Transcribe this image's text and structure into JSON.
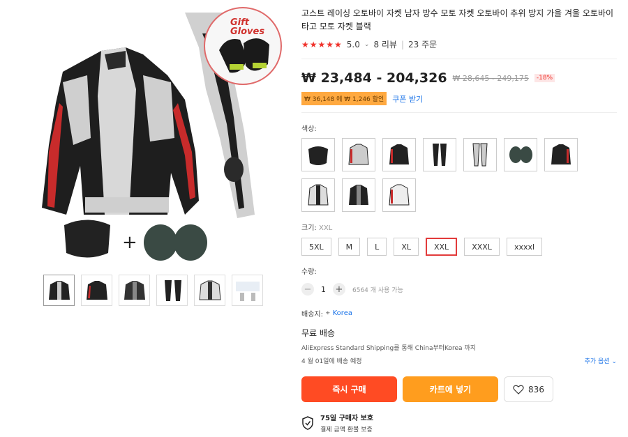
{
  "gallery": {
    "gift_label_1": "Gift",
    "gift_label_2": "Gloves",
    "thumbnails": [
      "jacket-front-1",
      "jacket-front-2",
      "jacket-front-3",
      "pants",
      "jacket-white",
      "size-chart"
    ]
  },
  "product": {
    "title": "고스트 레이싱 오토바이 자켓 남자 방수 모토 자켓 오토바이 추위 방지 가을 겨울 오토바이 타고 모토 자켓 블랙",
    "stars": "★★★★★",
    "rating": "5.0",
    "reviews": "8 리뷰",
    "orders": "23 주문"
  },
  "price": {
    "current": "₩ 23,484 - 204,326",
    "original": "₩ 28,645 - 249,175",
    "discount": "-18%",
    "coupon": "₩ 36,148 에 ₩ 1,246 할인",
    "coupon_link": "쿠폰 받기"
  },
  "color": {
    "label": "색상:",
    "options": [
      "neck-brace",
      "jacket-white-red",
      "jacket-black",
      "pants-black",
      "pants-white",
      "knee-pads",
      "jacket-black-red",
      "jacket-white-2",
      "jacket-black-2",
      "jacket-white-3"
    ]
  },
  "size": {
    "label": "크기:",
    "selected": "XXL",
    "options": [
      "5XL",
      "M",
      "L",
      "XL",
      "XXL",
      "XXXL",
      "xxxxl"
    ]
  },
  "quantity": {
    "label": "수량:",
    "value": "1",
    "minus": "−",
    "plus": "+",
    "available": "6564 개 사용 가능"
  },
  "shipping": {
    "to_label": "배송지:",
    "location": "Korea",
    "free": "무료 배송",
    "desc": "AliExpress Standard Shipping를 통해 China부터Korea 까지",
    "date": "4 월 01일에 배송 예정",
    "more": "추가 옵션"
  },
  "actions": {
    "buy": "즉시 구매",
    "cart": "카트에 넣기",
    "wish_count": "836"
  },
  "protection": {
    "title": "75일 구매자 보호",
    "subtitle": "결제 금액 환불 보증"
  }
}
